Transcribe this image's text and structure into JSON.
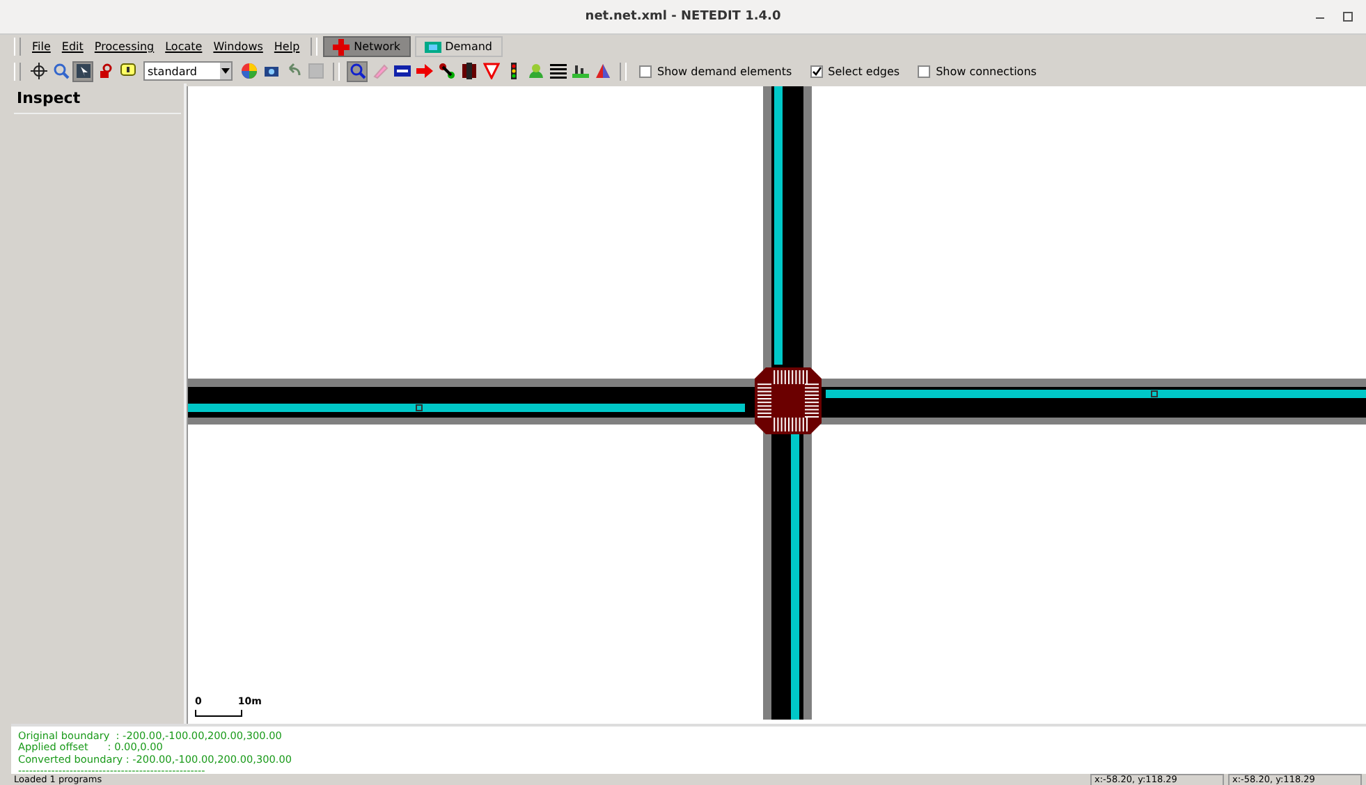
{
  "window": {
    "title": "net.net.xml - NETEDIT 1.4.0"
  },
  "menu": [
    "File",
    "Edit",
    "Processing",
    "Locate",
    "Windows",
    "Help"
  ],
  "modes": [
    {
      "label": "Network",
      "selected": true
    },
    {
      "label": "Demand",
      "selected": false
    }
  ],
  "scheme": {
    "value": "standard"
  },
  "options": [
    {
      "label": "Show demand elements",
      "checked": false
    },
    {
      "label": "Select edges",
      "checked": true
    },
    {
      "label": "Show connections",
      "checked": false
    }
  ],
  "sidebar": {
    "title": "Inspect"
  },
  "scale": {
    "start": "0",
    "end": "10m"
  },
  "messages": [
    "Original boundary  : -200.00,-100.00,200.00,300.00",
    "Applied offset      : 0.00,0.00",
    "Converted boundary : -200.00,-100.00,200.00,300.00",
    "---------------------------------------------------"
  ],
  "status_bar": {
    "message": "Loaded 1 programs",
    "coords": [
      "x:-58.20, y:118.29",
      "x:-58.20, y:118.29"
    ]
  }
}
